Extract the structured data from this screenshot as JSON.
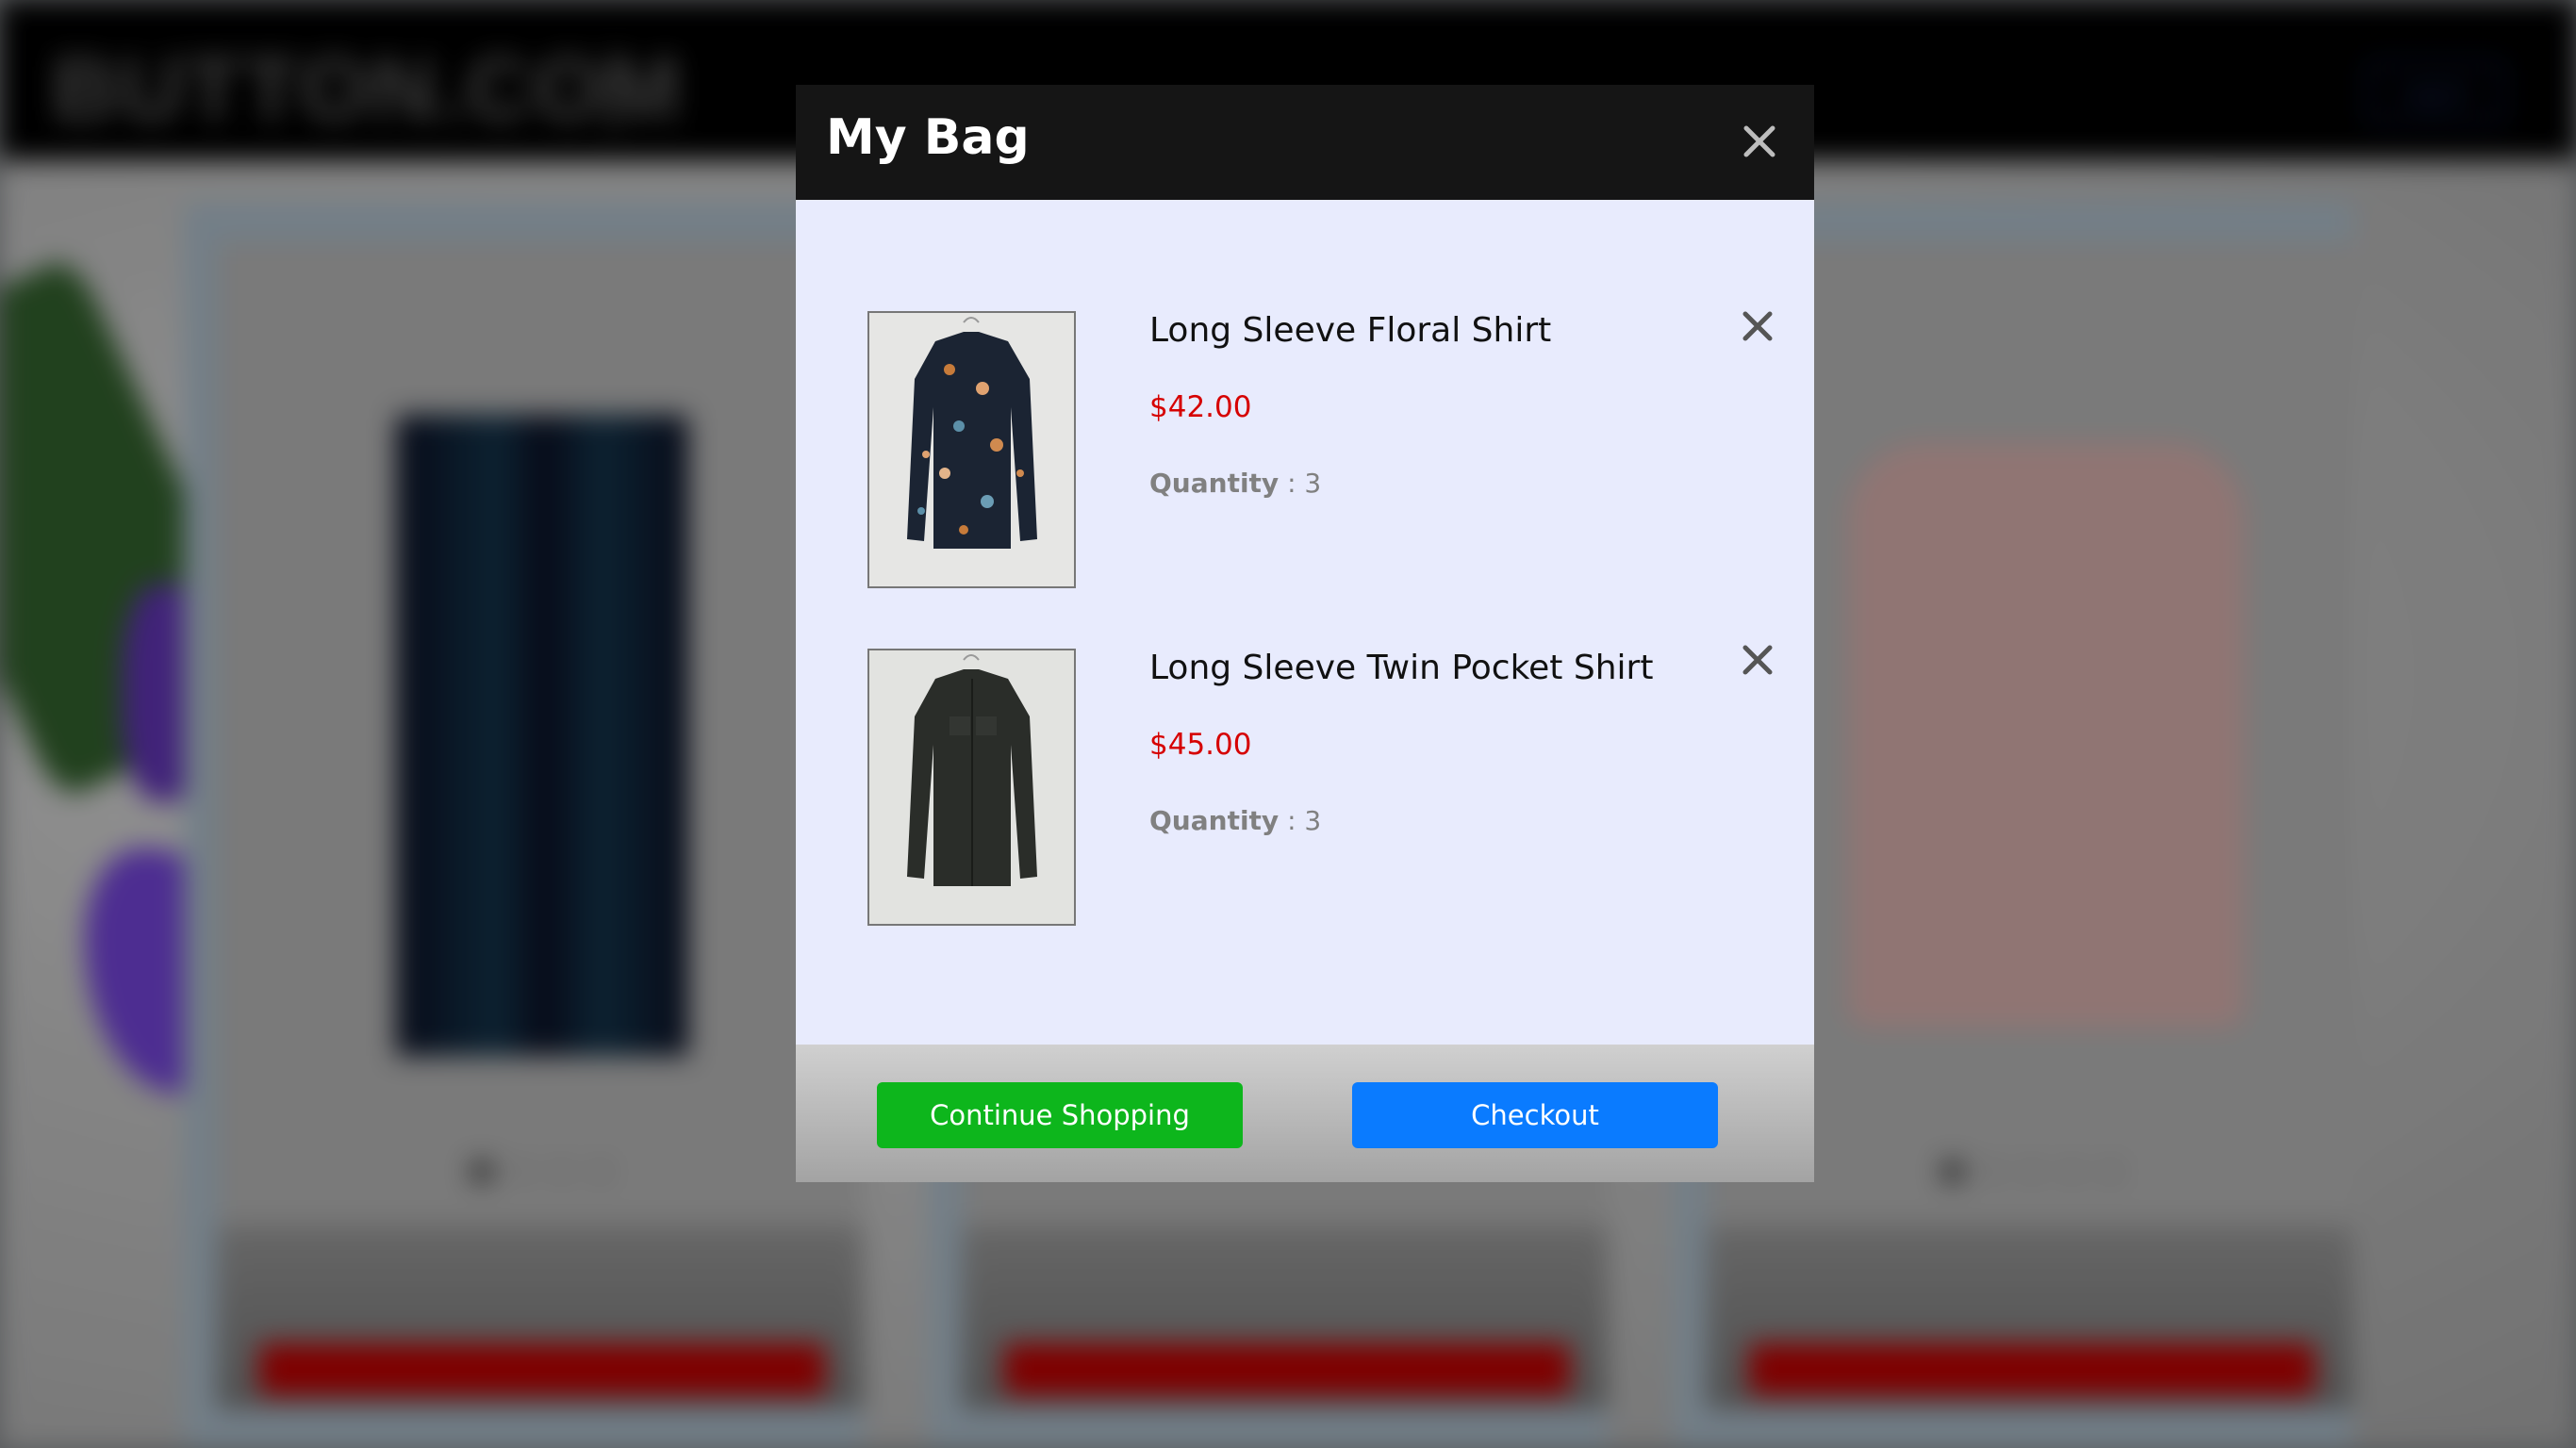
{
  "background_page": {
    "logo": "BUTTON.COM",
    "login_label": "Log In"
  },
  "modal": {
    "title": "My Bag",
    "items": [
      {
        "name": "Long Sleeve Floral Shirt",
        "price": "$42.00",
        "quantity_label": "Quantity",
        "quantity_value": ": 3",
        "image": "floral-shirt-image"
      },
      {
        "name": "Long Sleeve Twin Pocket Shirt",
        "price": "$45.00",
        "quantity_label": "Quantity",
        "quantity_value": ": 3",
        "image": "dark-shirt-image"
      }
    ],
    "buttons": {
      "continue_label": "Continue Shopping",
      "checkout_label": "Checkout"
    }
  },
  "colors": {
    "header_bg": "#151515",
    "modal_body_bg": "#e8ebfd",
    "price": "#d60000",
    "continue_button": "#0db61c",
    "checkout_button": "#0a7bff"
  },
  "icons": {
    "close": "close-icon",
    "remove": "remove-item-icon"
  }
}
